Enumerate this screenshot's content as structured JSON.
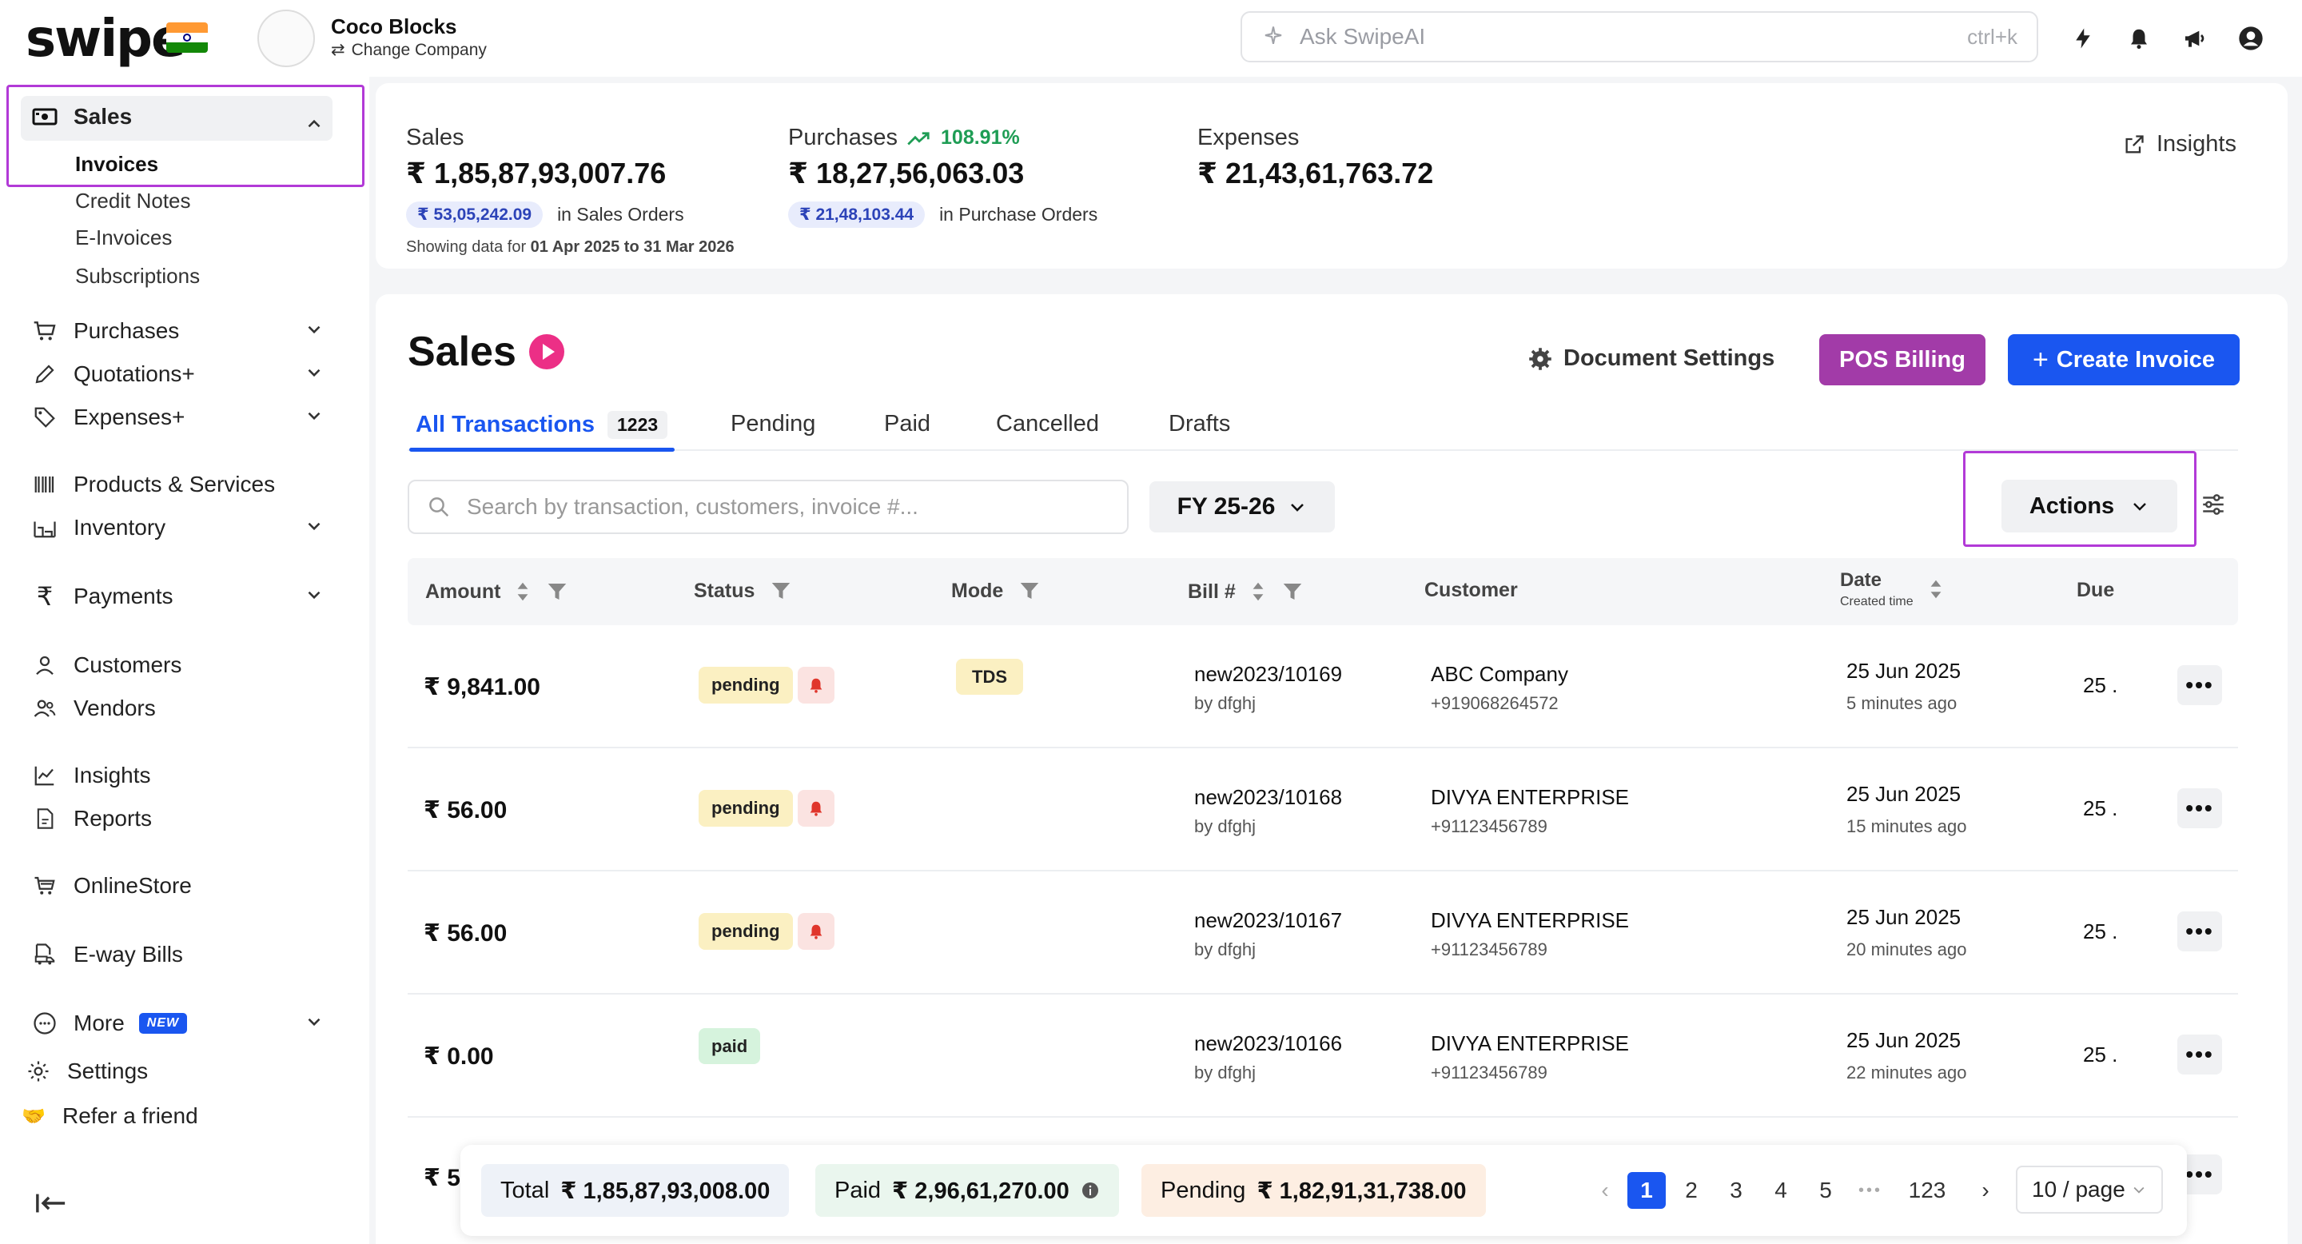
{
  "brand": {
    "logo": "swipe"
  },
  "company": {
    "name": "Coco Blocks",
    "change_label": "Change Company"
  },
  "search_ai": {
    "placeholder": "Ask SwipeAI",
    "shortcut": "ctrl+k"
  },
  "sidebar": {
    "sales": {
      "label": "Sales",
      "subitems": [
        "Invoices",
        "Credit Notes",
        "E-Invoices",
        "Subscriptions"
      ]
    },
    "items": [
      {
        "label": "Purchases"
      },
      {
        "label": "Quotations+"
      },
      {
        "label": "Expenses+"
      },
      {
        "label": "Products & Services"
      },
      {
        "label": "Inventory"
      },
      {
        "label": "Payments"
      },
      {
        "label": "Customers"
      },
      {
        "label": "Vendors"
      },
      {
        "label": "Insights"
      },
      {
        "label": "Reports"
      },
      {
        "label": "OnlineStore"
      },
      {
        "label": "E-way Bills"
      },
      {
        "label": "More",
        "badge": "NEW"
      },
      {
        "label": "Settings"
      },
      {
        "label": "Refer a friend"
      }
    ]
  },
  "summary": {
    "sales": {
      "label": "Sales",
      "value": "₹ 1,85,87,93,007.76",
      "pill": "₹ 53,05,242.09",
      "note": "in Sales Orders"
    },
    "purchases": {
      "label": "Purchases",
      "growth": "108.91%",
      "value": "₹ 18,27,56,063.03",
      "pill": "₹ 21,48,103.44",
      "note": "in Purchase Orders"
    },
    "expenses": {
      "label": "Expenses",
      "value": "₹ 21,43,61,763.72"
    },
    "showing_prefix": "Showing data for",
    "showing_range": "01 Apr 2025 to 31 Mar 2026",
    "insights_label": "Insights"
  },
  "main": {
    "title": "Sales",
    "doc_settings": "Document Settings",
    "pos_billing": "POS Billing",
    "create_invoice": "Create Invoice",
    "tabs": [
      {
        "label": "All Transactions",
        "count": "1223"
      },
      {
        "label": "Pending"
      },
      {
        "label": "Paid"
      },
      {
        "label": "Cancelled"
      },
      {
        "label": "Drafts"
      }
    ],
    "search_placeholder": "Search by transaction, customers, invoice #...",
    "fy": "FY 25-26",
    "actions": "Actions",
    "columns": {
      "amount": "Amount",
      "status": "Status",
      "mode": "Mode",
      "bill": "Bill #",
      "customer": "Customer",
      "date": "Date",
      "date_sub": "Created time",
      "due": "Due"
    },
    "rows": [
      {
        "amount": "₹ 9,841.00",
        "status": "pending",
        "mode": "TDS",
        "bill": "new2023/10169",
        "by": "by dfghj",
        "customer": "ABC Company",
        "phone": "+919068264572",
        "date": "25 Jun 2025",
        "ago": "5 minutes ago",
        "due": "25 ."
      },
      {
        "amount": "₹ 56.00",
        "status": "pending",
        "mode": "",
        "bill": "new2023/10168",
        "by": "by dfghj",
        "customer": "DIVYA ENTERPRISE",
        "phone": "+91123456789",
        "date": "25 Jun 2025",
        "ago": "15 minutes ago",
        "due": "25 ."
      },
      {
        "amount": "₹ 56.00",
        "status": "pending",
        "mode": "",
        "bill": "new2023/10167",
        "by": "by dfghj",
        "customer": "DIVYA ENTERPRISE",
        "phone": "+91123456789",
        "date": "25 Jun 2025",
        "ago": "20 minutes ago",
        "due": "25 ."
      },
      {
        "amount": "₹ 0.00",
        "status": "paid",
        "mode": "",
        "bill": "new2023/10166",
        "by": "by dfghj",
        "customer": "DIVYA ENTERPRISE",
        "phone": "+91123456789",
        "date": "25 Jun 2025",
        "ago": "22 minutes ago",
        "due": "25 ."
      }
    ],
    "partial_row_amount": "₹ 5"
  },
  "footer": {
    "total_label": "Total",
    "total_value": "₹ 1,85,87,93,008.00",
    "paid_label": "Paid",
    "paid_value": "₹ 2,96,61,270.00",
    "pending_label": "Pending",
    "pending_value": "₹ 1,82,91,31,738.00",
    "pages": [
      "1",
      "2",
      "3",
      "4",
      "5"
    ],
    "last_page": "123",
    "per_page": "10 / page"
  },
  "colors": {
    "accent_blue": "#1a56f0",
    "pos_purple": "#a23ba8",
    "highlight": "#b23ad7",
    "growth_green": "#1f9d55"
  }
}
